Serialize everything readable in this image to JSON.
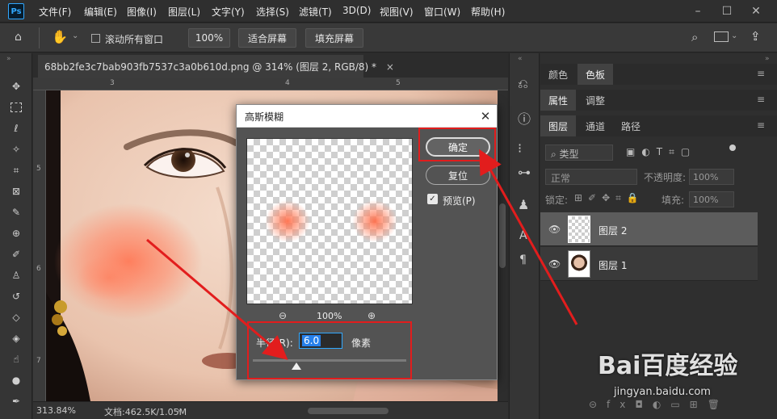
{
  "app": {
    "logo": "Ps"
  },
  "menu": [
    "文件(F)",
    "编辑(E)",
    "图像(I)",
    "图层(L)",
    "文字(Y)",
    "选择(S)",
    "滤镜(T)",
    "3D(D)",
    "视图(V)",
    "窗口(W)",
    "帮助(H)"
  ],
  "options": {
    "scroll_all": "滚动所有窗口",
    "zoom": "100%",
    "fit_screen": "适合屏幕",
    "fill_screen": "填充屏幕"
  },
  "document": {
    "tab_title": "68bb2fe3c7bab903fb7537c3a0b610d.png @ 314% (图层 2, RGB/8) *",
    "close": "×",
    "zoom_status": "313.84%",
    "doc_status": "文档:462.5K/1.05M"
  },
  "rulers": {
    "top": [
      "3",
      "4",
      "5"
    ],
    "left": [
      "5",
      "6",
      "7"
    ]
  },
  "panels": {
    "row1": [
      "颜色",
      "色板"
    ],
    "row2": [
      "属性",
      "调整"
    ],
    "row3": [
      "图层",
      "通道",
      "路径"
    ],
    "layer_filter": "类型",
    "blend_mode": "正常",
    "opacity_label": "不透明度:",
    "opacity_value": "100%",
    "lock_label": "锁定:",
    "fill_label": "填充:",
    "fill_value": "100%",
    "layers": [
      {
        "name": "图层 2",
        "selected": true
      },
      {
        "name": "图层 1",
        "selected": false
      }
    ]
  },
  "dialog": {
    "title": "高斯模糊",
    "ok": "确定",
    "reset": "复位",
    "preview_label": "预览(P)",
    "preview_checked": true,
    "zoom": "100%",
    "radius_label": "半径(R):",
    "radius_value": "6.0",
    "unit": "像素"
  },
  "watermark": {
    "brand": "Bai百度经验",
    "url": "jingyan.baidu.com"
  },
  "colors": {
    "accent": "#31a8ff",
    "annotation": "#e21d1d",
    "blush": "#ff8a6a"
  }
}
